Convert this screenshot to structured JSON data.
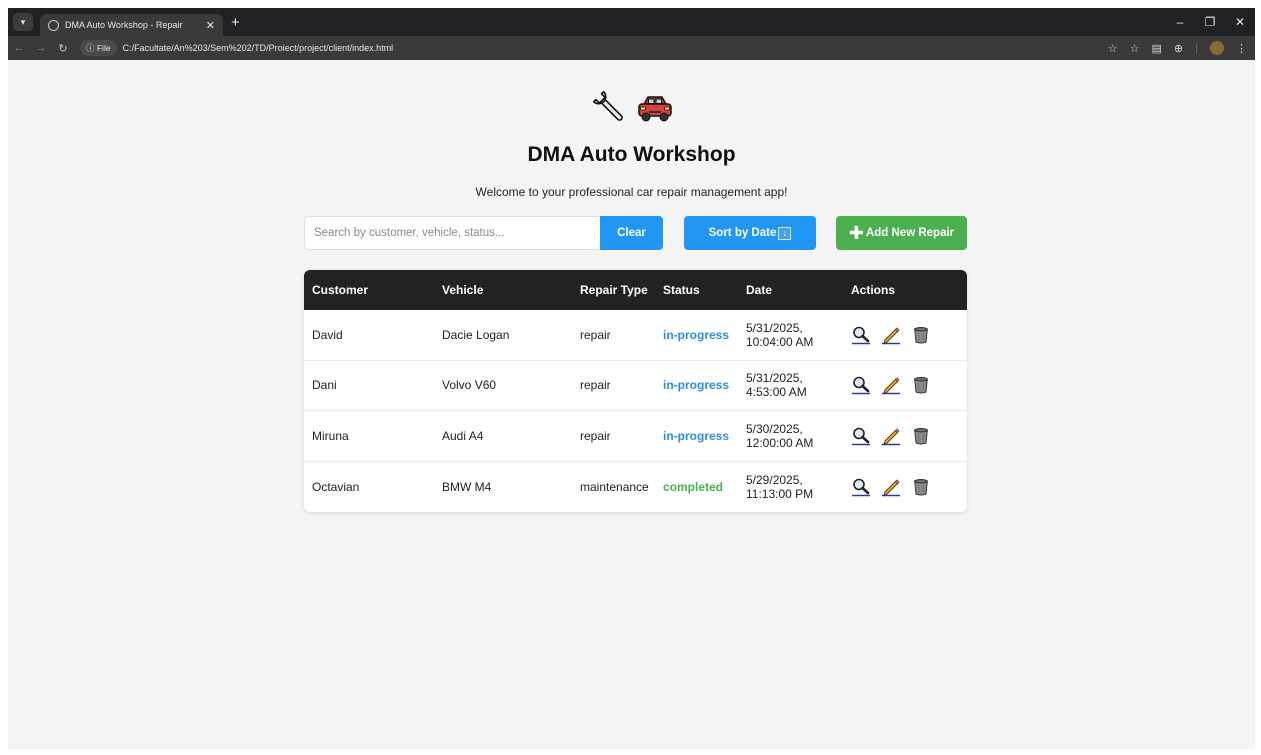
{
  "browser": {
    "tab_title": "DMA Auto Workshop - Repair",
    "tab_close": "✕",
    "new_tab": "+",
    "file_chip": "ⓘ File",
    "url": "C:/Facultate/An%203/Sem%202/TD/Proiect/project/client/index.html"
  },
  "header": {
    "title": "DMA Auto Workshop",
    "subtitle": "Welcome to your professional car repair management app!"
  },
  "controls": {
    "search_placeholder": "Search by customer, vehicle, status...",
    "search_value": "",
    "clear_label": "Clear",
    "sort_label": "Sort by Date",
    "sort_icon": "↓",
    "add_icon": "✚",
    "add_label": "Add New Repair"
  },
  "table": {
    "columns": [
      "Customer",
      "Vehicle",
      "Repair Type",
      "Status",
      "Date",
      "Actions"
    ],
    "rows": [
      {
        "customer": "David",
        "vehicle": "Dacie Logan",
        "repair_type": "repair",
        "status": "in-progress",
        "date": "5/31/2025,",
        "time": "10:04:00 AM"
      },
      {
        "customer": "Dani",
        "vehicle": "Volvo V60",
        "repair_type": "repair",
        "status": "in-progress",
        "date": "5/31/2025,",
        "time": "4:53:00 AM"
      },
      {
        "customer": "Miruna",
        "vehicle": "Audi A4",
        "repair_type": "repair",
        "status": "in-progress",
        "date": "5/30/2025,",
        "time": "12:00:00 AM"
      },
      {
        "customer": "Octavian",
        "vehicle": "BMW M4",
        "repair_type": "maintenance",
        "status": "completed",
        "date": "5/29/2025,",
        "time": "11:13:00 PM"
      }
    ]
  },
  "colors": {
    "primary_blue": "#2196f3",
    "success_green": "#4caf50",
    "table_header": "#222222",
    "in_progress": "#2e8ed8",
    "completed": "#4caf50"
  },
  "icons": {
    "hero": [
      "wrench-icon",
      "car-icon"
    ],
    "actions": [
      "magnifier-icon",
      "pencil-icon",
      "trash-icon"
    ]
  }
}
